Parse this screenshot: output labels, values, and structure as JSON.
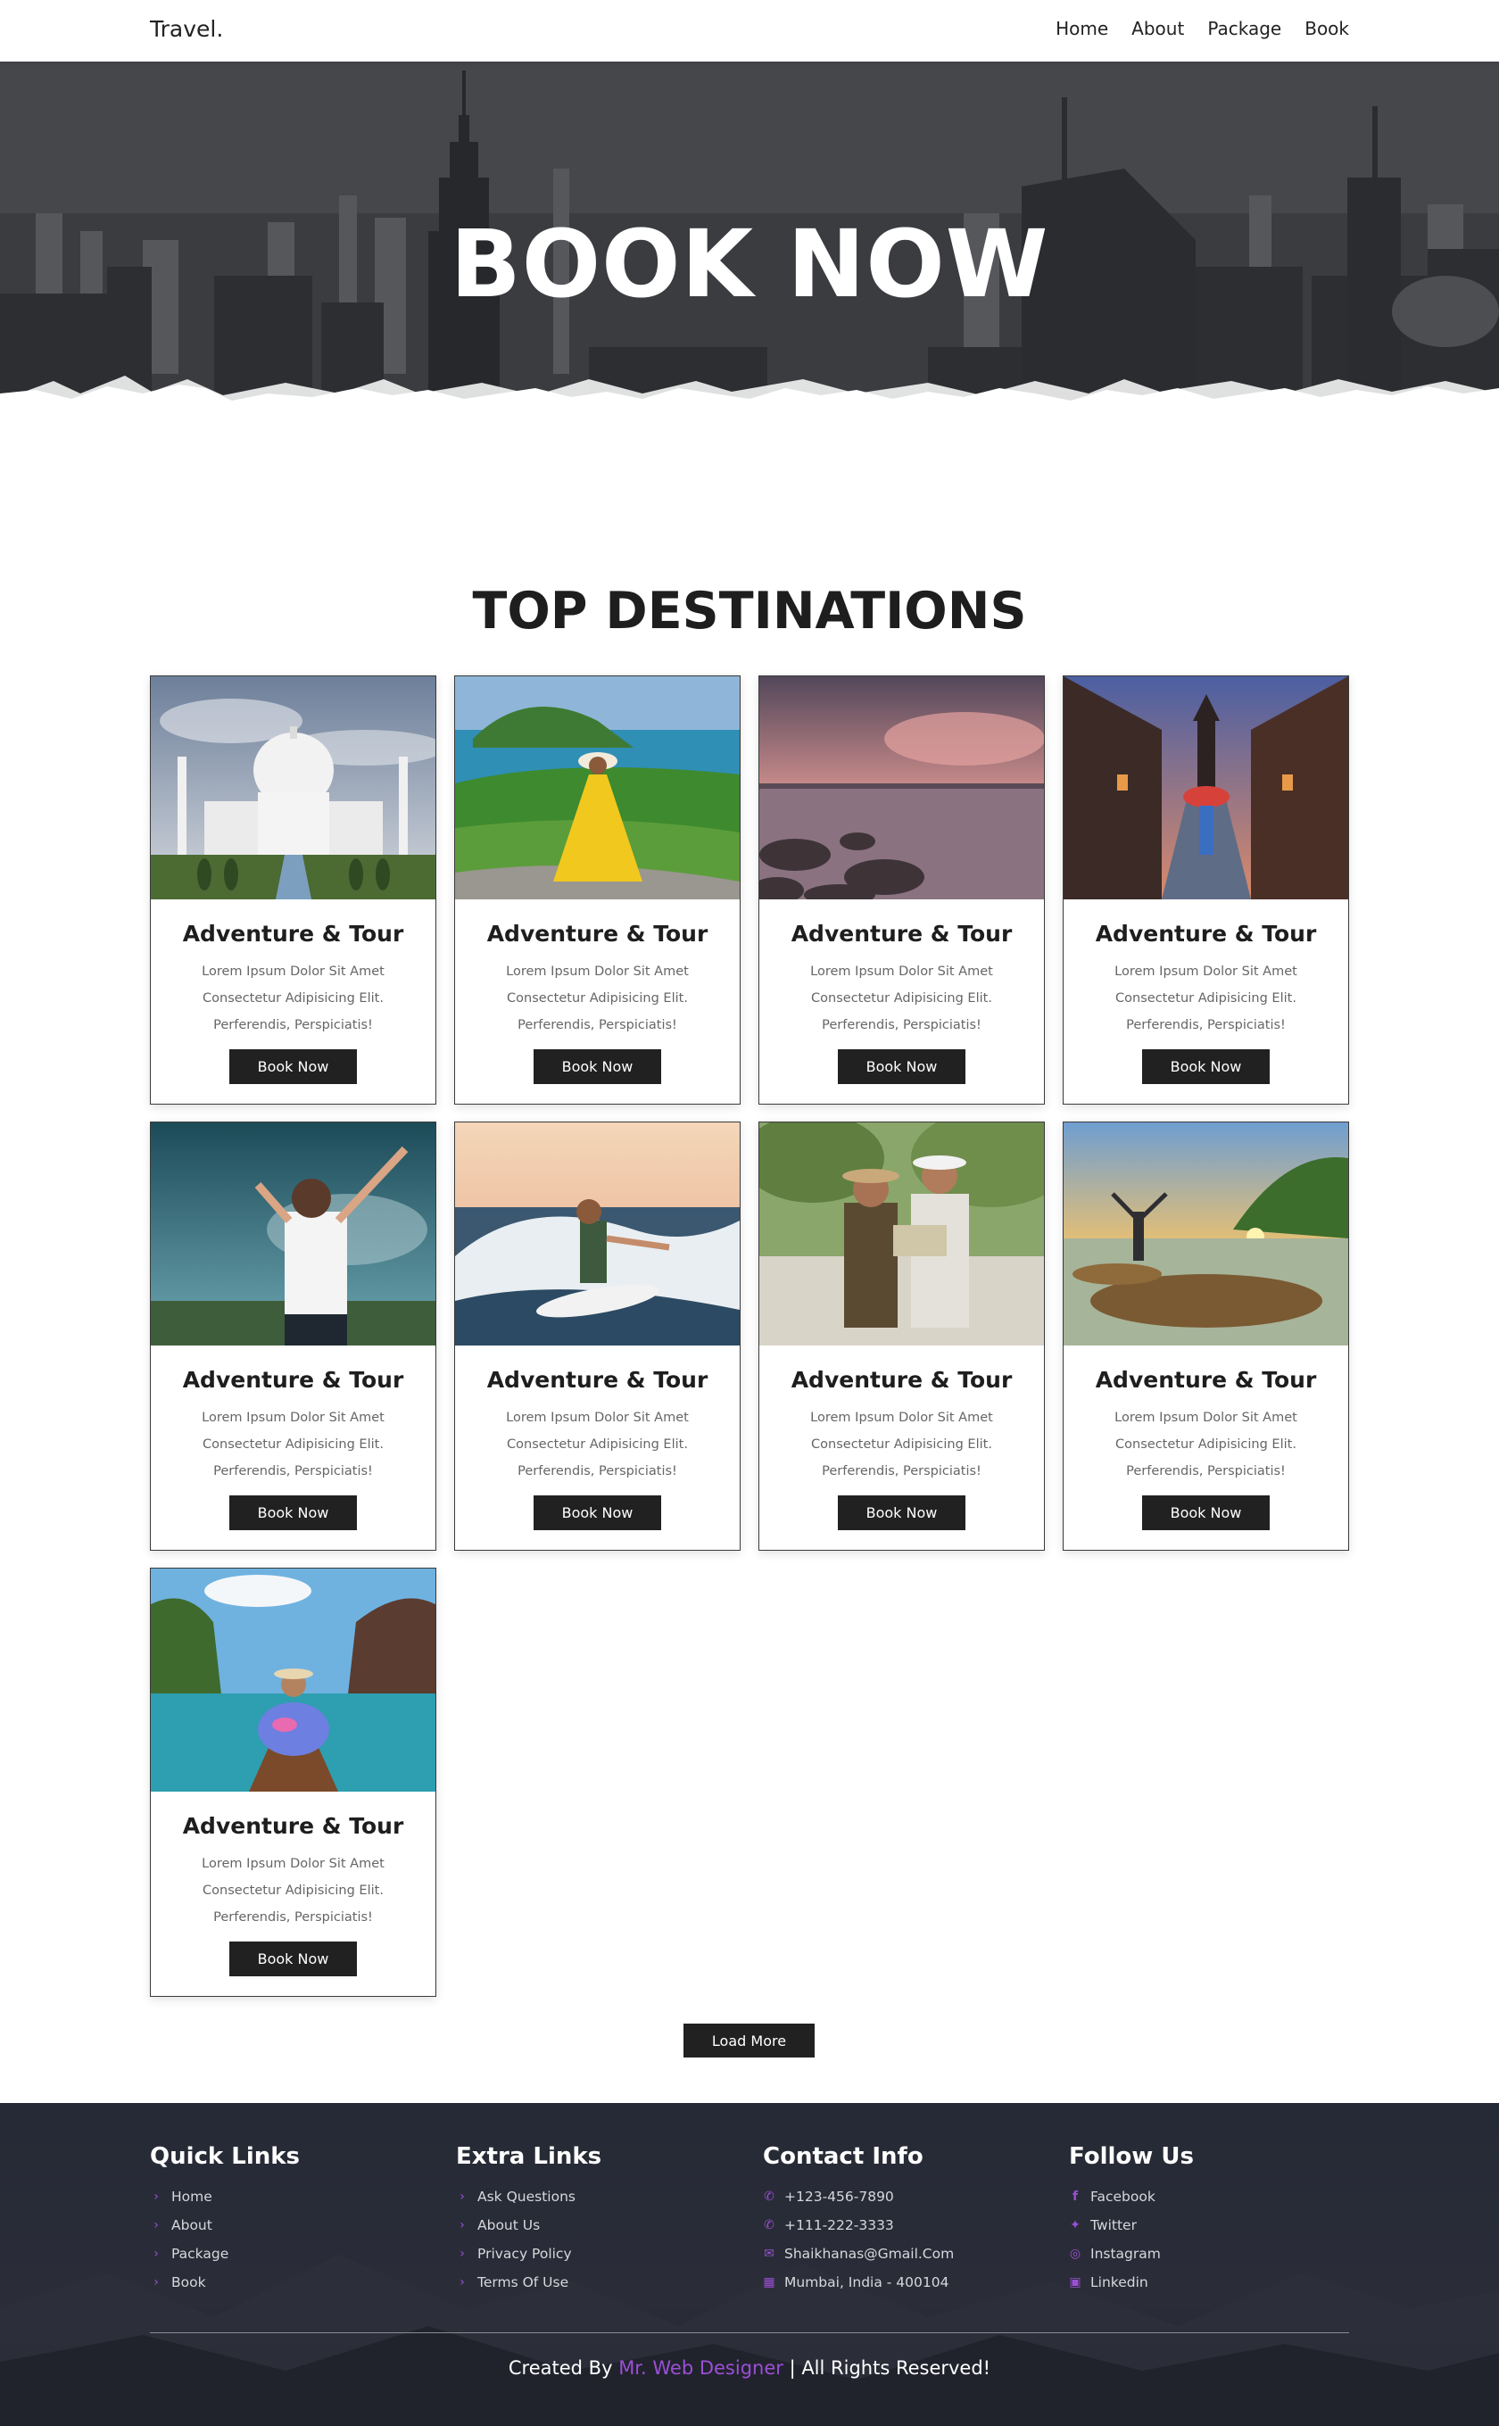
{
  "header": {
    "logo": "Travel.",
    "nav": [
      "Home",
      "About",
      "Package",
      "Book"
    ]
  },
  "hero": {
    "title": "BOOK NOW"
  },
  "section": {
    "title": "TOP DESTINATIONS"
  },
  "cards": [
    {
      "title": "Adventure & Tour",
      "text": [
        "Lorem Ipsum Dolor Sit Amet",
        "Consectetur Adipisicing Elit.",
        "Perferendis, Perspiciatis!"
      ],
      "button": "Book Now",
      "photo": "taj-mahal"
    },
    {
      "title": "Adventure & Tour",
      "text": [
        "Lorem Ipsum Dolor Sit Amet",
        "Consectetur Adipisicing Elit.",
        "Perferendis, Perspiciatis!"
      ],
      "button": "Book Now",
      "photo": "woman-on-hill"
    },
    {
      "title": "Adventure & Tour",
      "text": [
        "Lorem Ipsum Dolor Sit Amet",
        "Consectetur Adipisicing Elit.",
        "Perferendis, Perspiciatis!"
      ],
      "button": "Book Now",
      "photo": "sunset-lake"
    },
    {
      "title": "Adventure & Tour",
      "text": [
        "Lorem Ipsum Dolor Sit Amet",
        "Consectetur Adipisicing Elit.",
        "Perferendis, Perspiciatis!"
      ],
      "button": "Book Now",
      "photo": "kyoto-street"
    },
    {
      "title": "Adventure & Tour",
      "text": [
        "Lorem Ipsum Dolor Sit Amet",
        "Consectetur Adipisicing Elit.",
        "Perferendis, Perspiciatis!"
      ],
      "button": "Book Now",
      "photo": "woman-arms-up"
    },
    {
      "title": "Adventure & Tour",
      "text": [
        "Lorem Ipsum Dolor Sit Amet",
        "Consectetur Adipisicing Elit.",
        "Perferendis, Perspiciatis!"
      ],
      "button": "Book Now",
      "photo": "surfer"
    },
    {
      "title": "Adventure & Tour",
      "text": [
        "Lorem Ipsum Dolor Sit Amet",
        "Consectetur Adipisicing Elit.",
        "Perferendis, Perspiciatis!"
      ],
      "button": "Book Now",
      "photo": "couple-map"
    },
    {
      "title": "Adventure & Tour",
      "text": [
        "Lorem Ipsum Dolor Sit Amet",
        "Consectetur Adipisicing Elit.",
        "Perferendis, Perspiciatis!"
      ],
      "button": "Book Now",
      "photo": "beach-sunset"
    },
    {
      "title": "Adventure & Tour",
      "text": [
        "Lorem Ipsum Dolor Sit Amet",
        "Consectetur Adipisicing Elit.",
        "Perferendis, Perspiciatis!"
      ],
      "button": "Book Now",
      "photo": "woman-boat"
    }
  ],
  "load_more": "Load More",
  "footer": {
    "quick_links": {
      "title": "Quick Links",
      "items": [
        "Home",
        "About",
        "Package",
        "Book"
      ]
    },
    "extra_links": {
      "title": "Extra Links",
      "items": [
        "Ask Questions",
        "About Us",
        "Privacy Policy",
        "Terms Of Use"
      ]
    },
    "contact": {
      "title": "Contact Info",
      "items": [
        {
          "icon": "phone-icon",
          "text": "+123-456-7890"
        },
        {
          "icon": "phone-icon",
          "text": "+111-222-3333"
        },
        {
          "icon": "envelope-icon",
          "text": "Shaikhanas@Gmail.Com"
        },
        {
          "icon": "map-icon",
          "text": "Mumbai, India - 400104"
        }
      ]
    },
    "follow": {
      "title": "Follow Us",
      "items": [
        {
          "icon": "facebook-icon",
          "text": "Facebook"
        },
        {
          "icon": "twitter-icon",
          "text": "Twitter"
        },
        {
          "icon": "instagram-icon",
          "text": "Instagram"
        },
        {
          "icon": "linkedin-icon",
          "text": "Linkedin"
        }
      ]
    },
    "credit": {
      "prefix": "Created By ",
      "author": "Mr. Web Designer",
      "suffix": " | All Rights Reserved!"
    }
  },
  "colors": {
    "accent": "#9b4fd6",
    "dark_button": "#212121",
    "footer_bg": "#262a36"
  }
}
